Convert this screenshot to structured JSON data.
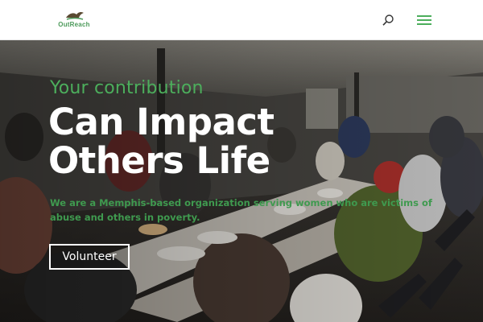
{
  "header": {
    "logo_text": "OutReach",
    "icons": {
      "search": "search-icon",
      "menu": "hamburger-menu-icon"
    },
    "accent_color": "#4cae5c"
  },
  "hero": {
    "subtitle": "Your contribution",
    "title_line1": "Can Impact",
    "title_line2": "Others Life",
    "description": "We are a Memphis-based organization serving women who are victims of abuse and others in poverty.",
    "cta_label": "Volunteer"
  },
  "colors": {
    "subtitle": "#4cae5c",
    "description": "#3f9a4f",
    "title": "#ffffff"
  }
}
